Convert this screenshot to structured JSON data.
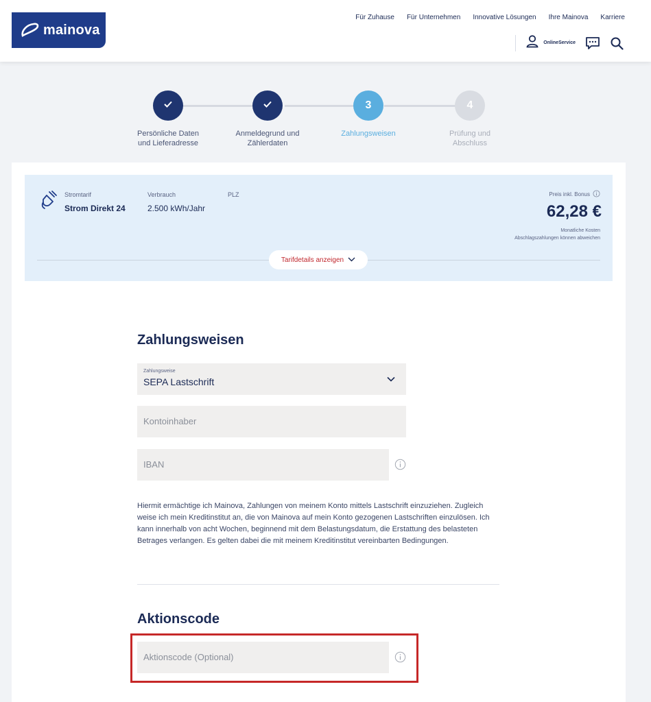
{
  "header": {
    "logo_text": "mainova",
    "nav": [
      "Für Zuhause",
      "Für Unternehmen",
      "Innovative Lösungen",
      "Ihre Mainova",
      "Karriere"
    ],
    "online_service_label": "OnlineService",
    "icons": {
      "user": "user-icon",
      "chat": "chat-icon",
      "search": "search-icon"
    }
  },
  "stepper": {
    "steps": [
      {
        "number": "1",
        "label_line1": "Persönliche Daten",
        "label_line2": "und Lieferadresse",
        "state": "done"
      },
      {
        "number": "2",
        "label_line1": "Anmeldegrund und",
        "label_line2": "Zählerdaten",
        "state": "done"
      },
      {
        "number": "3",
        "label_line1": "Zahlungsweisen",
        "label_line2": "",
        "state": "active"
      },
      {
        "number": "4",
        "label_line1": "Prüfung und",
        "label_line2": "Abschluss",
        "state": "todo"
      }
    ]
  },
  "tariff": {
    "tariff_label": "Stromtarif",
    "tariff_value": "Strom Direkt 24",
    "usage_label": "Verbrauch",
    "usage_value": "2.500 kWh/Jahr",
    "plz_label": "PLZ",
    "price_label": "Preis inkl. Bonus",
    "price_value": "62,28 €",
    "price_sub1": "Monatliche Kosten",
    "price_sub2": "Abschlagszahlungen können abweichen",
    "toggle_label": "Tarifdetails anzeigen"
  },
  "payment": {
    "title": "Zahlungsweisen",
    "method_label": "Zahlungsweise",
    "method_value": "SEPA Lastschrift",
    "holder_placeholder": "Kontoinhaber",
    "iban_placeholder": "IBAN",
    "consent_text": "Hiermit ermächtige ich Mainova, Zahlungen von meinem Konto mittels Lastschrift einzuziehen. Zugleich weise ich mein Kreditinstitut an, die von Mainova auf mein Konto gezogenen Lastschriften einzulösen. Ich kann innerhalb von acht Wochen, beginnend mit dem Belastungsdatum, die Erstattung des belasteten Betrages verlangen. Es gelten dabei die mit meinem Kreditinstitut vereinbarten Bedingungen."
  },
  "promo": {
    "title": "Aktionscode",
    "placeholder": "Aktionscode (Optional)"
  },
  "colors": {
    "brand": "#1f3c8a",
    "done": "#1f3570",
    "active": "#5aaedf",
    "highlight": "#c62828"
  }
}
